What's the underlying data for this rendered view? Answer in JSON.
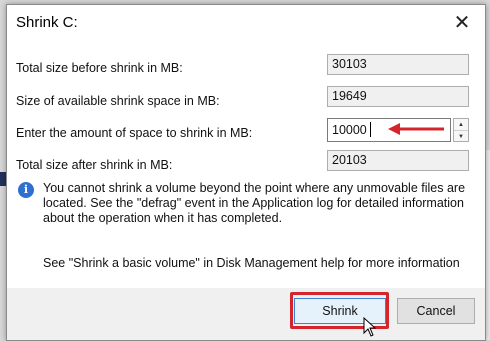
{
  "dialog": {
    "title": "Shrink C:",
    "close_glyph": "✕"
  },
  "fields": [
    {
      "label": "Total size before shrink in MB:",
      "value": "30103"
    },
    {
      "label": "Size of available shrink space in MB:",
      "value": "19649"
    },
    {
      "label": "Enter the amount of space to shrink in MB:",
      "value": "10000"
    },
    {
      "label": "Total size after shrink in MB:",
      "value": "20103"
    }
  ],
  "spinner": {
    "up_glyph": "▲",
    "down_glyph": "▼"
  },
  "info": {
    "icon": "info-icon",
    "glyph": "i",
    "message": "You cannot shrink a volume beyond the point where any unmovable files are located. See the \"defrag\" event in the Application log for detailed information about the operation when it has completed."
  },
  "help": "See \"Shrink a basic volume\" in Disk Management help for more information",
  "buttons": {
    "shrink": "Shrink",
    "cancel": "Cancel"
  },
  "colors": {
    "annotation_red": "#d4252d",
    "info_blue": "#2f6fd0",
    "focus_blue": "#3f7fd6"
  }
}
